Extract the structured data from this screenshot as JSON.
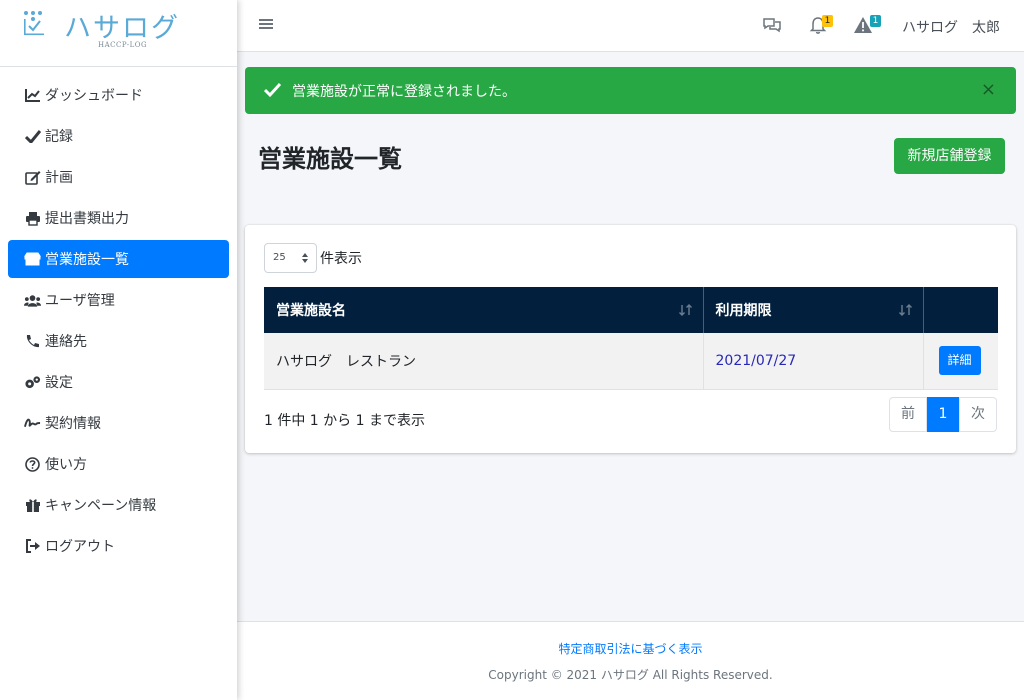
{
  "brand": {
    "name": "ハサログ",
    "subtitle": "HACCP-LOG"
  },
  "sidebar": {
    "items": [
      {
        "label": "ダッシュボード",
        "icon": "chart-line-icon"
      },
      {
        "label": "記録",
        "icon": "check-icon"
      },
      {
        "label": "計画",
        "icon": "edit-icon"
      },
      {
        "label": "提出書類出力",
        "icon": "print-icon"
      },
      {
        "label": "営業施設一覧",
        "icon": "store-icon",
        "active": true
      },
      {
        "label": "ユーザ管理",
        "icon": "users-icon"
      },
      {
        "label": "連絡先",
        "icon": "phone-icon"
      },
      {
        "label": "設定",
        "icon": "cogs-icon"
      },
      {
        "label": "契約情報",
        "icon": "signature-icon"
      },
      {
        "label": "使い方",
        "icon": "question-circle-icon"
      },
      {
        "label": "キャンペーン情報",
        "icon": "gift-icon"
      },
      {
        "label": "ログアウト",
        "icon": "sign-out-icon"
      }
    ]
  },
  "topbar": {
    "notification_count": "1",
    "alert_count": "1",
    "user_name": "ハサログ　太郎"
  },
  "alert": {
    "message": "営業施設が正常に登録されました。",
    "close": "×"
  },
  "page": {
    "title": "営業施設一覧",
    "new_button": "新規店舗登録"
  },
  "table": {
    "length_value": "25",
    "length_label": "件表示",
    "headers": [
      "営業施設名",
      "利用期限",
      ""
    ],
    "rows": [
      {
        "name": "ハサログ　レストラン",
        "expiry": "2021/07/27",
        "action": "詳細"
      }
    ],
    "info": "1 件中 1 から 1 まで表示",
    "pager": {
      "prev": "前",
      "current": "1",
      "next": "次"
    }
  },
  "footer": {
    "link": "特定商取引法に基づく表示",
    "copyright": "Copyright © 2021 ハサログ All Rights Reserved."
  },
  "colors": {
    "primary": "#007bff",
    "success": "#28a745",
    "table_header": "#021f3d"
  }
}
